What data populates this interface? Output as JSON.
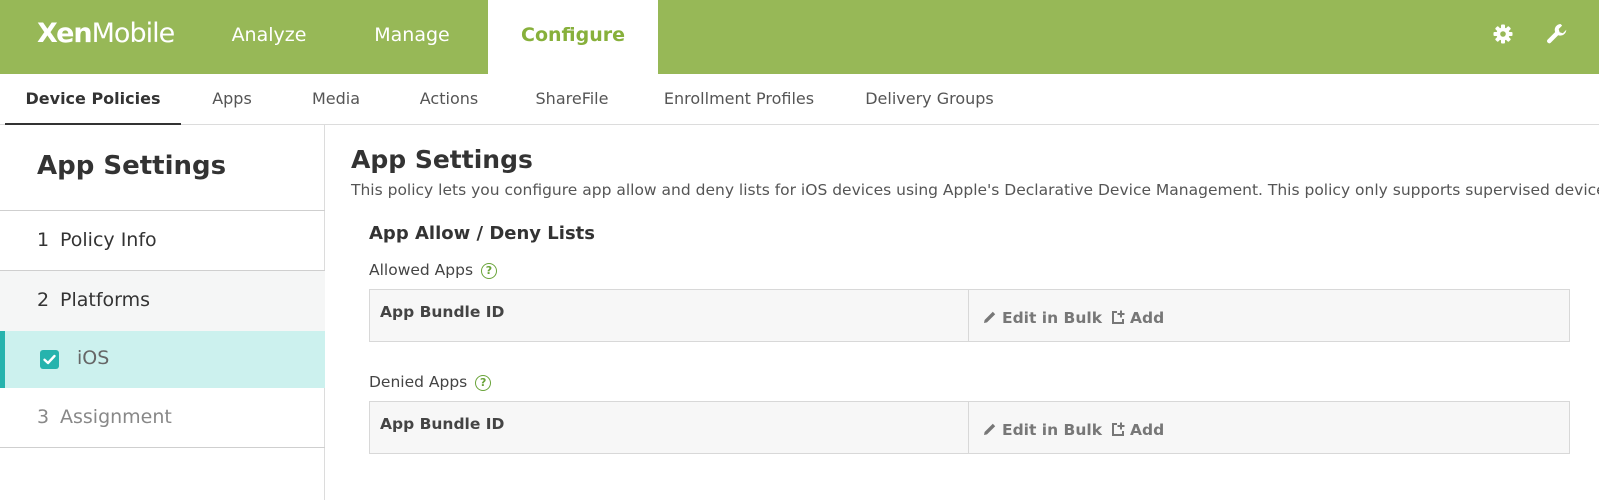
{
  "app": {
    "logo_bold": "Xen",
    "logo_light": "Mobile"
  },
  "top_nav": [
    {
      "label": "Analyze"
    },
    {
      "label": "Manage"
    },
    {
      "label": "Configure",
      "active": true
    }
  ],
  "top_icons": [
    "gear-icon",
    "wrench-icon"
  ],
  "sub_nav": [
    {
      "label": "Device Policies",
      "active": true
    },
    {
      "label": "Apps"
    },
    {
      "label": "Media"
    },
    {
      "label": "Actions"
    },
    {
      "label": "ShareFile"
    },
    {
      "label": "Enrollment Profiles"
    },
    {
      "label": "Delivery Groups"
    }
  ],
  "sidebar": {
    "title": "App Settings",
    "steps": [
      {
        "number": "1",
        "label": "Policy Info"
      },
      {
        "number": "2",
        "label": "Platforms"
      },
      {
        "number": "3",
        "label": "Assignment"
      }
    ],
    "platform": {
      "label": "iOS",
      "checked": true
    }
  },
  "main": {
    "title": "App Settings",
    "description": "This policy lets you configure app allow and deny lists for iOS devices using Apple's Declarative Device Management. This policy only supports supervised devices.",
    "section_title": "App Allow / Deny Lists",
    "allowed": {
      "label": "Allowed Apps",
      "help": "?",
      "column_header": "App Bundle ID",
      "edit_bulk": "Edit in Bulk",
      "add": "Add"
    },
    "denied": {
      "label": "Denied Apps",
      "help": "?",
      "column_header": "App Bundle ID",
      "edit_bulk": "Edit in Bulk",
      "add": "Add"
    }
  },
  "colors": {
    "brand_green": "#97b857",
    "active_green": "#87b03b",
    "teal_accent": "#26b3ad",
    "selected_bg": "#ccf1ee"
  }
}
